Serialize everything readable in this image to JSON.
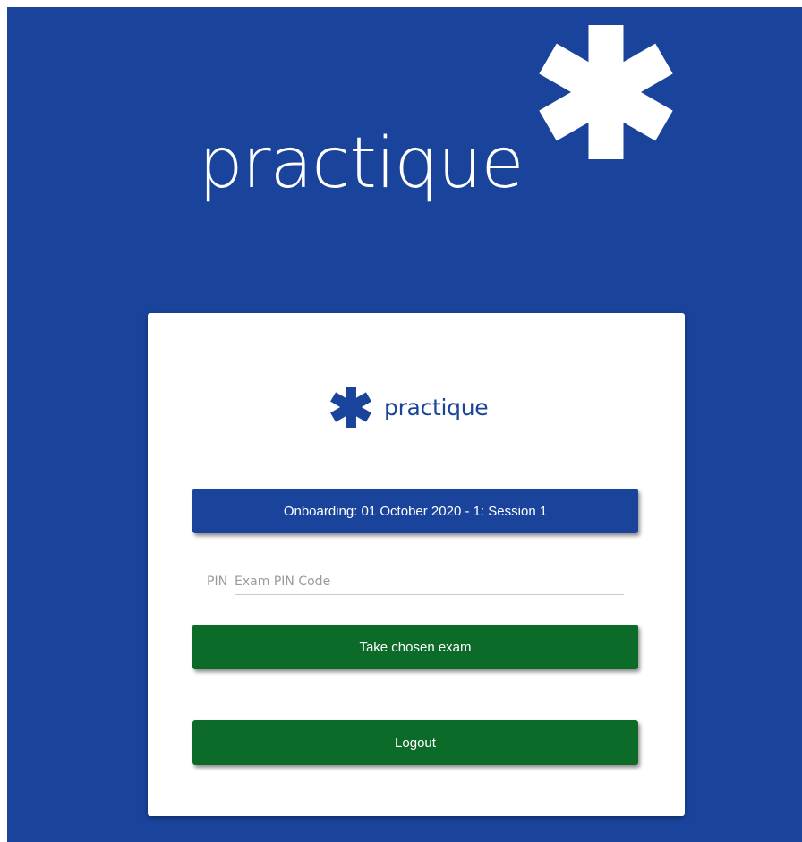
{
  "brand": {
    "name": "practique",
    "primary_color": "#1a449b",
    "action_color": "#0d6b2a",
    "logo_icon": "asterisk-icon"
  },
  "form": {
    "exam_button_label": "Onboarding: 01 October 2020 - 1: Session 1",
    "pin_label": "PIN",
    "pin_placeholder": "Exam PIN Code",
    "pin_value": "",
    "take_exam_label": "Take chosen exam",
    "logout_label": "Logout"
  }
}
